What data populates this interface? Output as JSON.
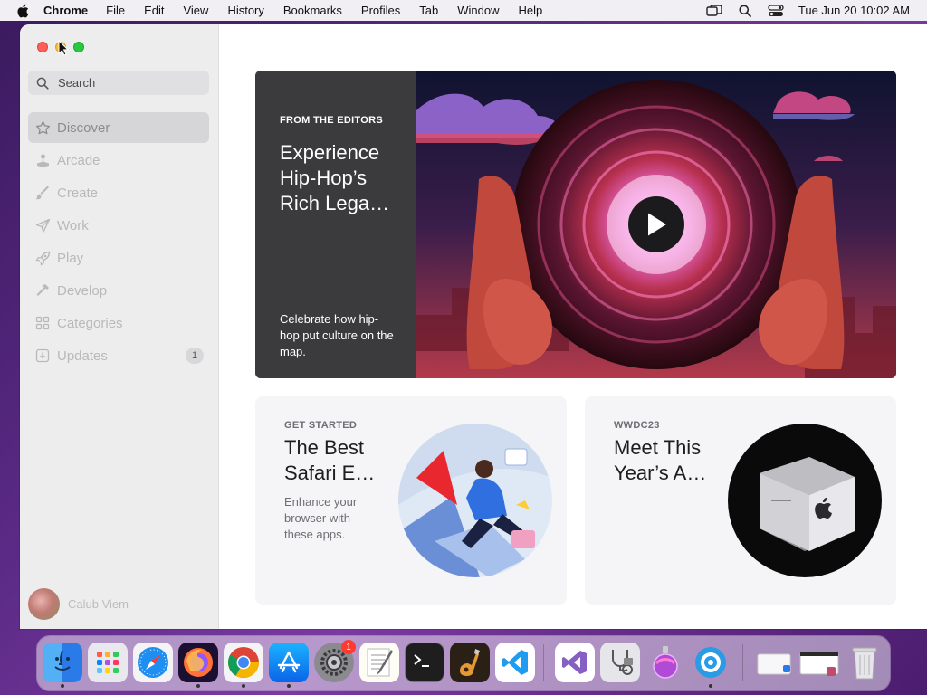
{
  "menubar": {
    "app_name": "Chrome",
    "items": [
      "File",
      "Edit",
      "View",
      "History",
      "Bookmarks",
      "Profiles",
      "Tab",
      "Window",
      "Help"
    ],
    "clock": "Tue Jun 20  10:02 AM",
    "status_icons": [
      "screen-mirroring-icon",
      "spotlight-search-icon",
      "control-center-icon"
    ]
  },
  "sidebar": {
    "search_placeholder": "Search",
    "items": [
      {
        "label": "Discover",
        "icon": "star-icon",
        "active": true
      },
      {
        "label": "Arcade",
        "icon": "joystick-icon"
      },
      {
        "label": "Create",
        "icon": "brush-icon"
      },
      {
        "label": "Work",
        "icon": "paper-plane-icon"
      },
      {
        "label": "Play",
        "icon": "rocket-icon"
      },
      {
        "label": "Develop",
        "icon": "hammer-icon"
      },
      {
        "label": "Categories",
        "icon": "grid-icon"
      },
      {
        "label": "Updates",
        "icon": "download-icon",
        "badge": "1"
      }
    ],
    "user_name": "Calub Viem"
  },
  "hero": {
    "eyebrow": "FROM THE EDITORS",
    "title": "Experience Hip-Hop’s Rich Lega…",
    "description": "Celebrate how hip-hop put culture on the map."
  },
  "cards": [
    {
      "eyebrow": "GET STARTED",
      "title": "The Best Safari E…",
      "description": "Enhance your browser with these apps."
    },
    {
      "eyebrow": "WWDC23",
      "title": "Meet This Year’s A…",
      "description": ""
    }
  ],
  "dock": {
    "items": [
      {
        "name": "finder-icon",
        "running": true
      },
      {
        "name": "launchpad-icon",
        "running": false
      },
      {
        "name": "safari-icon",
        "running": false
      },
      {
        "name": "firefox-icon",
        "running": true
      },
      {
        "name": "chrome-icon",
        "running": true
      },
      {
        "name": "app-store-icon",
        "running": true
      },
      {
        "name": "system-settings-icon",
        "running": false,
        "badge": "1"
      },
      {
        "name": "textedit-icon",
        "running": false
      },
      {
        "name": "terminal-icon",
        "running": false
      },
      {
        "name": "garageband-icon",
        "running": false
      },
      {
        "name": "vscode-icon",
        "running": false
      },
      {
        "name": "visual-studio-icon",
        "running": false
      },
      {
        "name": "disk-utility-icon",
        "running": false
      },
      {
        "name": "app-icon",
        "running": false
      },
      {
        "name": "proxyman-icon",
        "running": true
      },
      {
        "name": "downloads-stack-icon",
        "running": false
      },
      {
        "name": "window-stack-icon",
        "running": false
      },
      {
        "name": "trash-icon",
        "running": false
      }
    ]
  },
  "colors": {
    "accent": "#0a84ff",
    "sidebar_bg": "#ededee",
    "hero_text_bg": "#3b3b3d"
  }
}
